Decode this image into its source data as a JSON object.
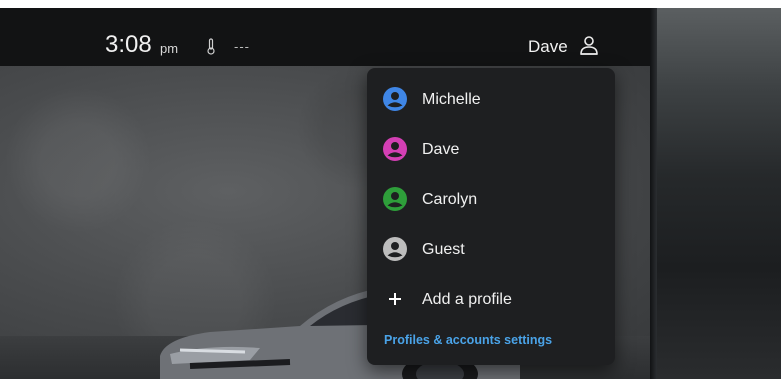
{
  "status_bar": {
    "time": "3:08",
    "ampm": "pm",
    "temperature": "---",
    "temperature_icon": "thermometer-icon",
    "current_user": "Dave",
    "user_icon": "person-outline-icon"
  },
  "profile_menu": {
    "profiles": [
      {
        "name": "Michelle",
        "color": "#3f86e6",
        "icon": "account-circle-icon"
      },
      {
        "name": "Dave",
        "color": "#d43fb4",
        "icon": "account-circle-icon"
      },
      {
        "name": "Carolyn",
        "color": "#2e9e3a",
        "icon": "account-circle-icon"
      },
      {
        "name": "Guest",
        "color": "#bdbdbd",
        "icon": "account-circle-icon"
      }
    ],
    "add_profile_label": "Add a profile",
    "add_icon": "plus-icon",
    "settings_link": "Profiles & accounts settings",
    "link_color": "#4aa3e8"
  }
}
